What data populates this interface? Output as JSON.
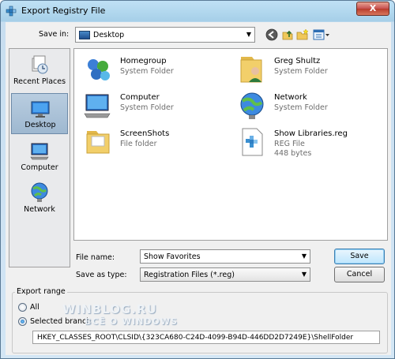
{
  "window": {
    "title": "Export Registry File",
    "close_label": "X"
  },
  "toolbar": {
    "save_in_label": "Save in:",
    "save_in_value": "Desktop"
  },
  "places": [
    {
      "label": "Recent Places",
      "icon": "recent-places-icon"
    },
    {
      "label": "Desktop",
      "icon": "desktop-icon",
      "selected": true
    },
    {
      "label": "Computer",
      "icon": "computer-icon"
    },
    {
      "label": "Network",
      "icon": "network-icon"
    }
  ],
  "files": [
    {
      "name": "Homegroup",
      "type": "System Folder",
      "icon": "homegroup-icon"
    },
    {
      "name": "Greg Shultz",
      "type": "System Folder",
      "icon": "user-folder-icon"
    },
    {
      "name": "Computer",
      "type": "System Folder",
      "icon": "computer-icon"
    },
    {
      "name": "Network",
      "type": "System Folder",
      "icon": "network-icon"
    },
    {
      "name": "ScreenShots",
      "type": "File folder",
      "icon": "folder-icon"
    },
    {
      "name": "Show Libraries.reg",
      "type": "REG File",
      "size": "448 bytes",
      "icon": "reg-file-icon"
    }
  ],
  "form": {
    "filename_label": "File name:",
    "filename_value": "Show Favorites",
    "savetype_label": "Save as type:",
    "savetype_value": "Registration Files (*.reg)",
    "save_button": "Save",
    "cancel_button": "Cancel"
  },
  "export_range": {
    "title": "Export range",
    "all_label": "All",
    "selected_label": "Selected branch",
    "selected": "selected_branch",
    "key_path": "HKEY_CLASSES_ROOT\\CLSID\\{323CA680-C24D-4099-B94D-446DD2D7249E}\\ShellFolder"
  },
  "watermark": {
    "line1": "WINBLOG.RU",
    "line2": "ВСЁ О WINDOWS"
  }
}
